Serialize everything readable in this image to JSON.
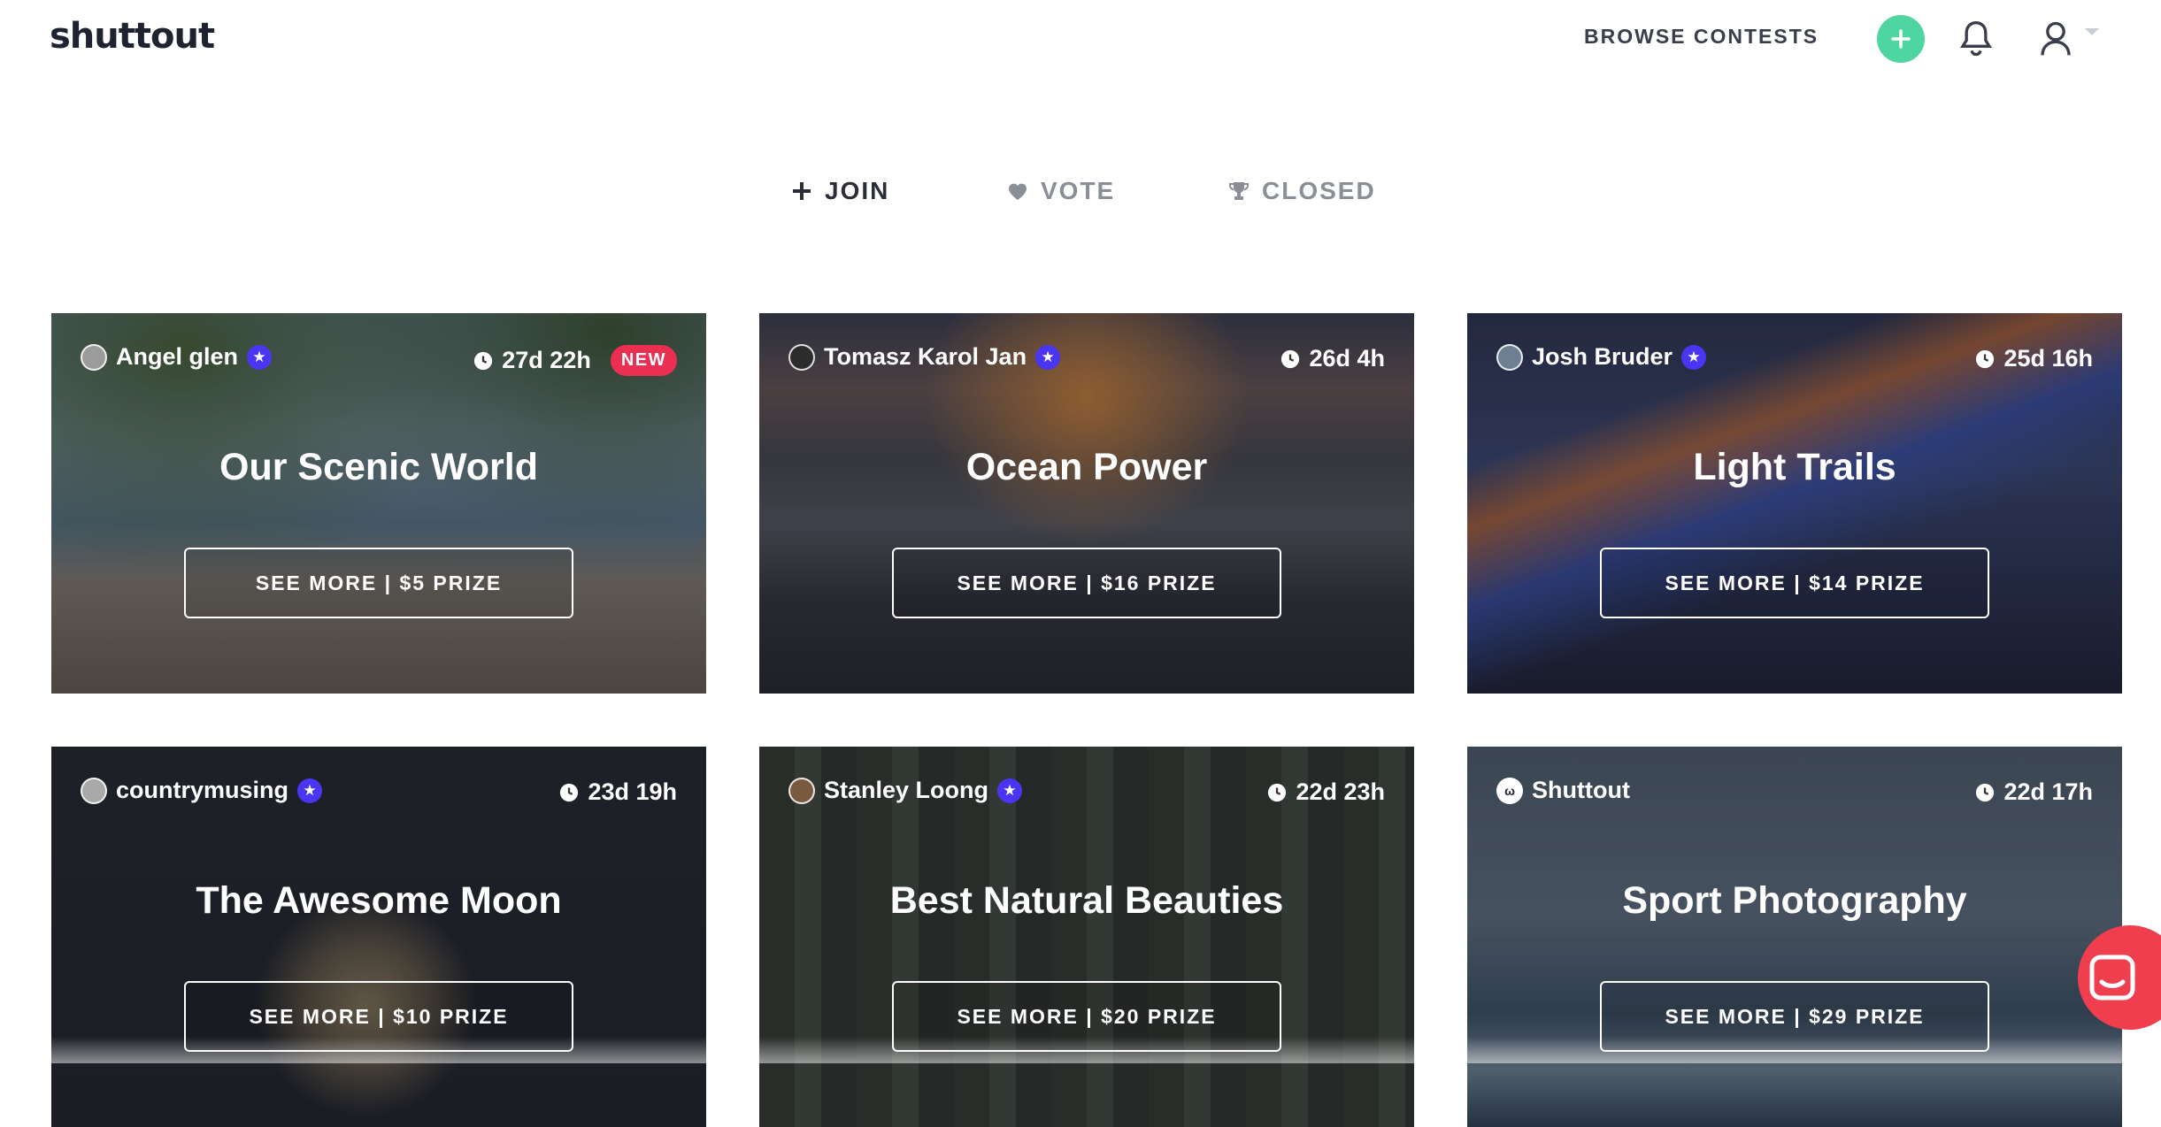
{
  "header": {
    "logo": "shuttout",
    "browse_label": "BROWSE CONTESTS",
    "icons": {
      "add": "plus-icon",
      "notifications": "bell-icon",
      "user": "user-icon",
      "caret": "chevron-down-icon"
    }
  },
  "tabs": [
    {
      "label": "JOIN",
      "icon": "plus-icon",
      "active": true
    },
    {
      "label": "VOTE",
      "icon": "heart-icon",
      "active": false
    },
    {
      "label": "CLOSED",
      "icon": "trophy-icon",
      "active": false
    }
  ],
  "contests": [
    {
      "owner": "Angel glen",
      "verified": true,
      "time_left": "27d 22h",
      "badge": "NEW",
      "title": "Our Scenic World",
      "cta": "SEE MORE | $5 PRIZE"
    },
    {
      "owner": "Tomasz Karol Jan",
      "verified": true,
      "time_left": "26d 4h",
      "title": "Ocean Power",
      "cta": "SEE MORE | $16 PRIZE"
    },
    {
      "owner": "Josh Bruder",
      "verified": true,
      "time_left": "25d 16h",
      "title": "Light Trails",
      "cta": "SEE MORE | $14 PRIZE"
    },
    {
      "owner": "countrymusing",
      "verified": true,
      "time_left": "23d 19h",
      "title": "The Awesome Moon",
      "cta": "SEE MORE | $10 PRIZE"
    },
    {
      "owner": "Stanley Loong",
      "verified": true,
      "time_left": "22d 23h",
      "title": "Best Natural Beauties",
      "cta": "SEE MORE | $20 PRIZE"
    },
    {
      "owner": "Shuttout",
      "verified": false,
      "time_left": "22d 17h",
      "title": "Sport Photography",
      "cta": "SEE MORE | $29 PRIZE"
    }
  ],
  "colors": {
    "accent_green": "#4fd6a0",
    "badge_new": "#ea2f52",
    "verified_star": "#4a35f2",
    "chat": "#ef3f4e"
  }
}
